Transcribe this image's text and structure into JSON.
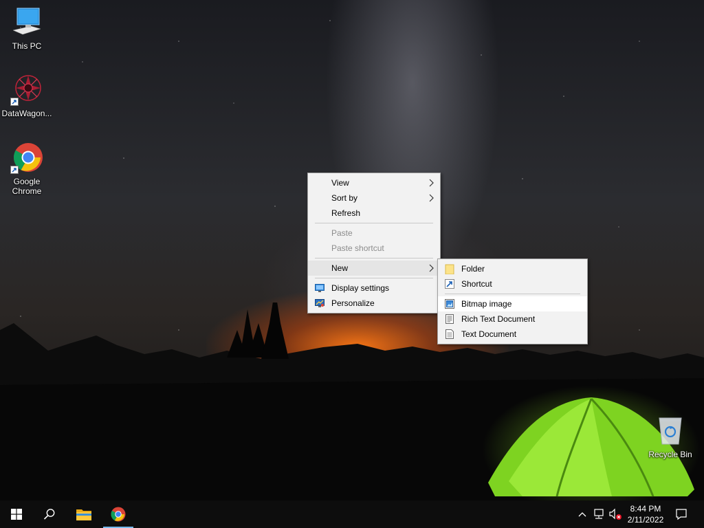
{
  "desktop": {
    "icons": [
      {
        "label": "This PC",
        "icon": "this-pc-icon"
      },
      {
        "label": "DataWagon...",
        "icon": "datawagon-icon"
      },
      {
        "label": "Google Chrome",
        "icon": "chrome-icon"
      },
      {
        "label": "Recycle Bin",
        "icon": "recycle-bin-icon"
      }
    ]
  },
  "context_menu": {
    "items": [
      {
        "label": "View",
        "submenu": true
      },
      {
        "label": "Sort by",
        "submenu": true
      },
      {
        "label": "Refresh"
      },
      {
        "label": "Paste",
        "disabled": true
      },
      {
        "label": "Paste shortcut",
        "disabled": true
      },
      {
        "label": "New",
        "submenu": true,
        "hovered": true
      },
      {
        "label": "Display settings",
        "icon": "display-settings-icon"
      },
      {
        "label": "Personalize",
        "icon": "personalize-icon"
      }
    ]
  },
  "new_submenu": {
    "items": [
      {
        "label": "Folder",
        "icon": "folder-icon"
      },
      {
        "label": "Shortcut",
        "icon": "shortcut-icon"
      },
      {
        "label": "Bitmap image",
        "icon": "bitmap-icon",
        "highlighted": true
      },
      {
        "label": "Rich Text Document",
        "icon": "rich-text-icon"
      },
      {
        "label": "Text Document",
        "icon": "text-document-icon"
      }
    ]
  },
  "taskbar": {
    "start_icon": "windows-start-icon",
    "search_icon": "search-icon",
    "pinned": [
      {
        "name": "file-explorer",
        "icon": "file-explorer-icon"
      },
      {
        "name": "google-chrome",
        "icon": "chrome-icon",
        "active": true
      }
    ],
    "tray": {
      "icons": [
        "chevron-up-icon",
        "network-icon",
        "volume-muted-icon"
      ],
      "time": "8:44 PM",
      "date": "2/11/2022",
      "notification_icon": "notification-icon"
    }
  },
  "colors": {
    "menu_background": "#f2f2f2",
    "menu_hover": "#e5e5e5",
    "taskbar": "#0d0d0d",
    "active_indicator": "#76b9ed"
  }
}
